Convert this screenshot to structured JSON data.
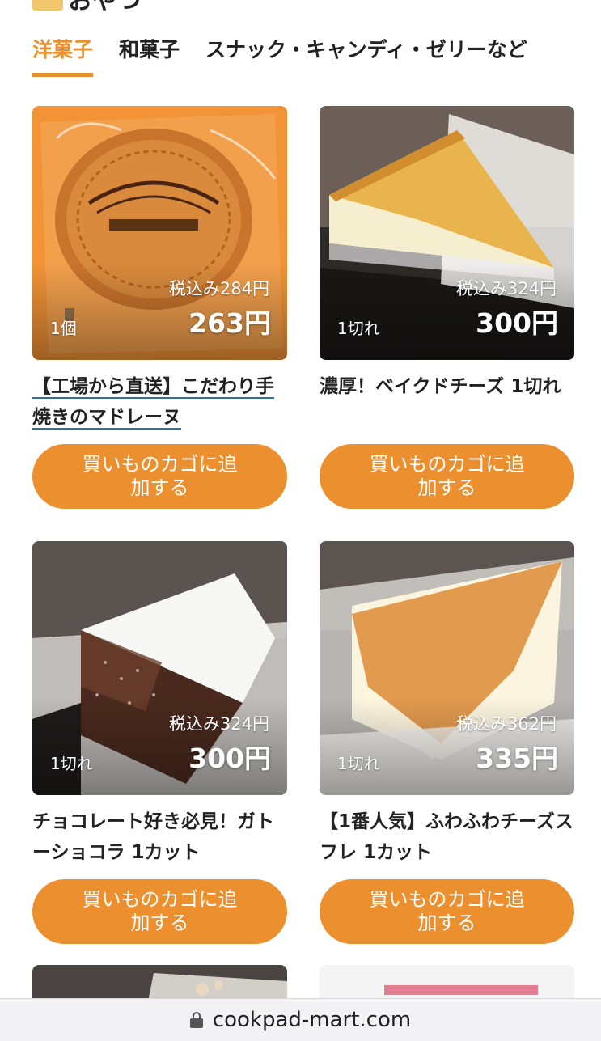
{
  "section": {
    "title": "おやつ"
  },
  "tabs": [
    {
      "label": "洋菓子",
      "active": true
    },
    {
      "label": "和菓子",
      "active": false
    },
    {
      "label": "スナック・キャンディ・ゼリーなど",
      "active": false
    }
  ],
  "products": [
    {
      "name": "【工場から直送】こだわり手焼きのマドレーヌ",
      "unit": "1個",
      "tax_in": "税込み284円",
      "price": "263円",
      "cart_label": "買いものカゴに追加する",
      "image": "madeleine-photo"
    },
    {
      "name": "濃厚！ベイクドチーズ 1切れ",
      "unit": "1切れ",
      "tax_in": "税込み324円",
      "price": "300円",
      "cart_label": "買いものカゴに追加する",
      "image": "baked-cheesecake-photo"
    },
    {
      "name": "チョコレート好き必見！ガトーショコラ 1カット",
      "unit": "1切れ",
      "tax_in": "税込み324円",
      "price": "300円",
      "cart_label": "買いものカゴに追加する",
      "image": "gateau-chocolat-photo"
    },
    {
      "name": "【1番人気】ふわふわチーズスフレ 1カット",
      "unit": "1切れ",
      "tax_in": "税込み362円",
      "price": "335円",
      "cart_label": "買いものカゴに追加する",
      "image": "cheese-souffle-photo"
    }
  ],
  "browser": {
    "url": "cookpad-mart.com",
    "icon": "lock-icon"
  },
  "colors": {
    "accent": "#ec8f2f",
    "link_underline": "#2d6fa6"
  }
}
